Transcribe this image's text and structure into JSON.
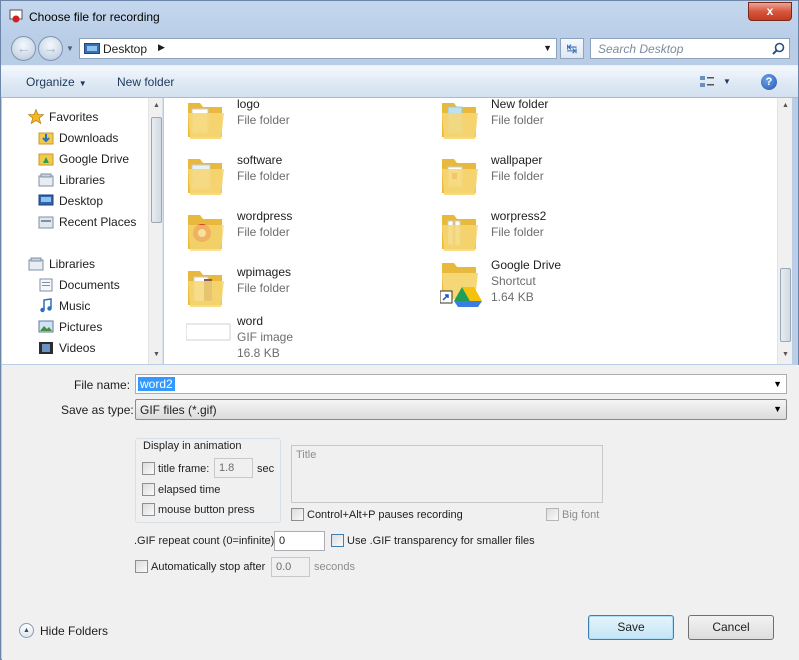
{
  "window": {
    "title": "Choose file for recording",
    "close_label": "x"
  },
  "address": {
    "location": "Desktop"
  },
  "search": {
    "placeholder": "Search Desktop"
  },
  "toolbar": {
    "organize_label": "Organize",
    "new_folder_label": "New folder"
  },
  "nav": {
    "favorites": [
      {
        "label": "Favorites",
        "icon": "star-icon"
      },
      {
        "label": "Downloads",
        "icon": "downloads-folder-icon"
      },
      {
        "label": "Google Drive",
        "icon": "google-drive-folder-icon"
      },
      {
        "label": "Libraries",
        "icon": "libraries-icon"
      },
      {
        "label": "Desktop",
        "icon": "desktop-icon"
      },
      {
        "label": "Recent Places",
        "icon": "recent-places-icon"
      }
    ],
    "libraries": [
      {
        "label": "Libraries",
        "icon": "libraries-icon"
      },
      {
        "label": "Documents",
        "icon": "documents-icon"
      },
      {
        "label": "Music",
        "icon": "music-icon"
      },
      {
        "label": "Pictures",
        "icon": "pictures-icon"
      },
      {
        "label": "Videos",
        "icon": "videos-icon"
      }
    ]
  },
  "files": [
    {
      "name": "logo",
      "type": "File folder",
      "size": "",
      "icon": "folder-icon"
    },
    {
      "name": "New folder",
      "type": "File folder",
      "size": "",
      "icon": "folder-icon"
    },
    {
      "name": "software",
      "type": "File folder",
      "size": "",
      "icon": "folder-icon"
    },
    {
      "name": "wallpaper",
      "type": "File folder",
      "size": "",
      "icon": "folder-icon"
    },
    {
      "name": "wordpress",
      "type": "File folder",
      "size": "",
      "icon": "folder-icon"
    },
    {
      "name": "worpress2",
      "type": "File folder",
      "size": "",
      "icon": "folder-icon"
    },
    {
      "name": "wpimages",
      "type": "File folder",
      "size": "",
      "icon": "folder-icon"
    },
    {
      "name": "Google Drive",
      "type": "Shortcut",
      "size": "1.64 KB",
      "icon": "google-drive-shortcut-icon"
    },
    {
      "name": "word",
      "type": "GIF image",
      "size": "16.8 KB",
      "icon": "gif-image-icon"
    }
  ],
  "form": {
    "file_name_label": "File name:",
    "file_name_value": "word2",
    "save_type_label": "Save as type:",
    "save_type_value": "GIF files (*.gif)",
    "display_group_title": "Display in animation",
    "title_frame_label": "title frame:",
    "title_frame_value": "1.8",
    "title_frame_unit": "sec",
    "elapsed_time_label": "elapsed time",
    "mouse_press_label": "mouse button press",
    "title_placeholder": "Title",
    "pause_label": "Control+Alt+P pauses recording",
    "big_font_label": "Big font",
    "gif_repeat_label": ".GIF repeat count (0=infinite):",
    "gif_repeat_value": "0",
    "transparency_label": "Use .GIF transparency for smaller files",
    "auto_stop_label": "Automatically stop after",
    "auto_stop_value": "0.0",
    "auto_stop_unit": "seconds"
  },
  "footer": {
    "hide_folders_label": "Hide Folders",
    "save_label": "Save",
    "cancel_label": "Cancel"
  },
  "colors": {
    "accent": "#3399ff",
    "frame": "#c4d7ee",
    "folder": "#f2c94c"
  }
}
